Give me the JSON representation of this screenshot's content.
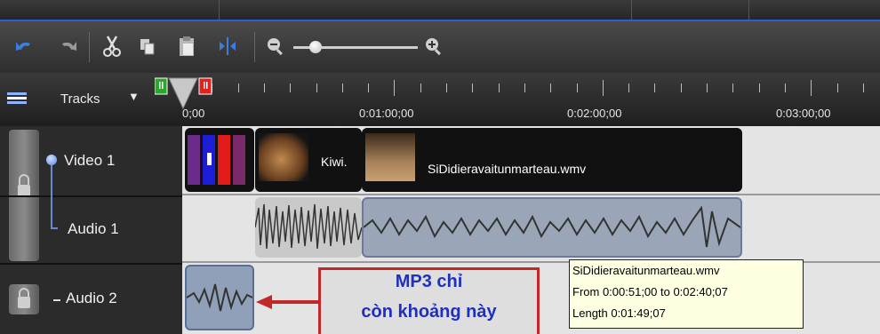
{
  "toolbar": {
    "buttons": [
      "undo-icon",
      "redo-icon",
      "cut-icon",
      "copy-icon",
      "paste-icon",
      "split-icon",
      "zoom-out-icon",
      "zoom-in-icon"
    ],
    "zoom_level": 0.15
  },
  "tracks_menu": {
    "label": "Tracks"
  },
  "ruler": {
    "labels": [
      "0;00",
      "0:01:00;00",
      "0:02:00;00",
      "0:03:00;00"
    ]
  },
  "tracks": [
    {
      "name": "Video 1"
    },
    {
      "name": "Audio 1"
    },
    {
      "name": "Audio 2"
    }
  ],
  "clips": {
    "kiwi": "Kiwi.",
    "video_main": "SiDidieravaitunmarteau.wmv"
  },
  "tooltip": {
    "line1": "SiDidieravaitunmarteau.wmv",
    "line2": "From 0:00:51;00 to 0:02:40;07",
    "line3": "Length 0:01:49;07"
  },
  "callout": {
    "line1": "MP3 chỉ",
    "line2": "còn khoảng này"
  },
  "colors": {
    "accent_blue": "#2d5fd0",
    "callout_red": "#c0282a",
    "callout_text": "#1f2fbf",
    "tooltip_bg": "#ffffe1"
  }
}
